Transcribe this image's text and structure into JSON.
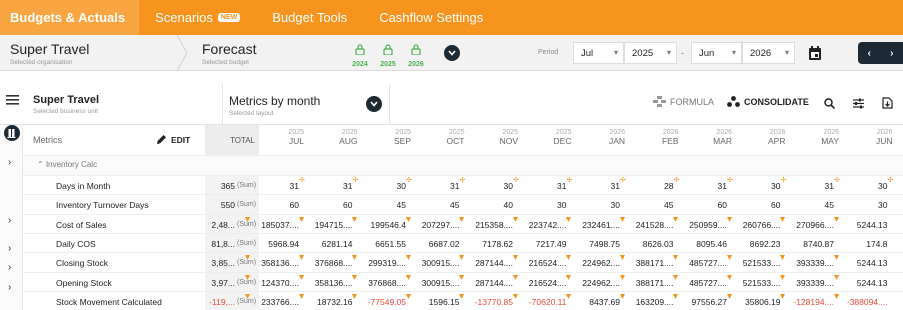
{
  "nav": {
    "items": [
      "Budgets & Actuals",
      "Scenarios",
      "Budget Tools",
      "Cashflow Settings"
    ],
    "new_badge": "NEW"
  },
  "org": {
    "name": "Super Travel",
    "caption": "Selected organisation"
  },
  "budget": {
    "name": "Forecast",
    "caption": "Selected budget"
  },
  "years": [
    "2024",
    "2025",
    "2026"
  ],
  "period": {
    "label": "Period",
    "start_month": "Jul",
    "start_year": "2025",
    "separator": "-",
    "end_month": "Jun",
    "end_year": "2026"
  },
  "business_unit": {
    "name": "Super Travel",
    "caption": "Selected business unit"
  },
  "layout": {
    "name": "Metrics by month",
    "caption": "Selected layout"
  },
  "toolbar": {
    "formula": "FORMULA",
    "consolidate": "CONSOLIDATE"
  },
  "grid": {
    "metrics_header": "Metrics",
    "edit_label": "EDIT",
    "total_header": "TOTAL",
    "group": "Inventory Calc",
    "sum_label": "(Sum)",
    "months": [
      {
        "year": "2025",
        "month": "JUL"
      },
      {
        "year": "2025",
        "month": "AUG"
      },
      {
        "year": "2025",
        "month": "SEP"
      },
      {
        "year": "2025",
        "month": "OCT"
      },
      {
        "year": "2025",
        "month": "NOV"
      },
      {
        "year": "2025",
        "month": "DEC"
      },
      {
        "year": "2026",
        "month": "JAN"
      },
      {
        "year": "2026",
        "month": "FEB"
      },
      {
        "year": "2026",
        "month": "MAR"
      },
      {
        "year": "2026",
        "month": "APR"
      },
      {
        "year": "2026",
        "month": "MAY"
      },
      {
        "year": "2026",
        "month": "JUN"
      }
    ],
    "rows": [
      {
        "label": "Days in Month",
        "total": "365",
        "values": [
          "31",
          "31",
          "30",
          "31",
          "30",
          "31",
          "31",
          "28",
          "31",
          "30",
          "31",
          "30"
        ],
        "flag": "plus"
      },
      {
        "label": "Inventory Turnover Days",
        "total": "550",
        "values": [
          "60",
          "60",
          "45",
          "45",
          "40",
          "30",
          "30",
          "45",
          "60",
          "60",
          "45",
          "30"
        ]
      },
      {
        "label": "Cost of Sales",
        "total": "2,48...",
        "values": [
          "185037....",
          "194715....",
          "199546.4",
          "207297....",
          "215358....",
          "223742....",
          "232461....",
          "241528....",
          "250959....",
          "260766....",
          "270966....",
          "5244.13"
        ],
        "flag": "tri"
      },
      {
        "label": "Daily COS",
        "total": "81,8...",
        "values": [
          "5968.94",
          "6281.14",
          "6651.55",
          "6687.02",
          "7178.62",
          "7217.49",
          "7498.75",
          "8626.03",
          "8095.46",
          "8692.23",
          "8740.87",
          "174.8"
        ]
      },
      {
        "label": "Closing Stock",
        "total": "3,85...",
        "values": [
          "358136....",
          "376868....",
          "299319....",
          "300915....",
          "287144....",
          "216524....",
          "224962....",
          "388171....",
          "485727....",
          "521533....",
          "393339....",
          "5244.13"
        ],
        "flag": "tri"
      },
      {
        "label": "Opening Stock",
        "total": "3,97...",
        "values": [
          "124370....",
          "358136....",
          "376868....",
          "300915....",
          "287144....",
          "216524....",
          "224962....",
          "388171....",
          "485727....",
          "521533....",
          "393339....",
          "5244.13"
        ],
        "flag": "tri"
      },
      {
        "label": "Stock Movement Calculated",
        "total": "-119,...",
        "values": [
          "233766....",
          "18732.16",
          "-77549.05",
          "1596.15",
          "-13770.85",
          "-70620.11",
          "8437.69",
          "163209....",
          "97556.27",
          "35806.19",
          "-128194....",
          "-388094...."
        ],
        "flag": "tri"
      }
    ]
  },
  "colors": {
    "brand": "#f7941d",
    "dark": "#1d2a33",
    "negative": "#e64a3b",
    "locked": "#4caf50"
  }
}
